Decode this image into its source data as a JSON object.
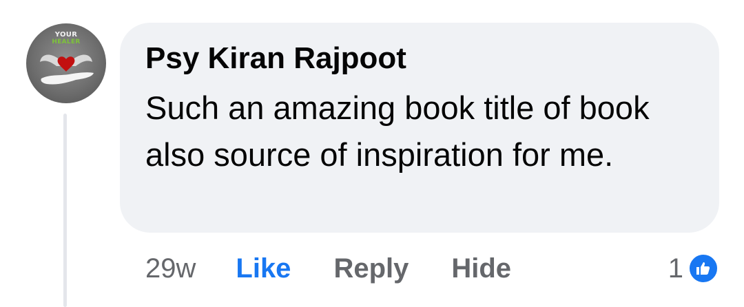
{
  "comment": {
    "avatar": {
      "text_top": "YOUR",
      "text_bottom": "HEALER"
    },
    "author": "Psy Kiran Rajpoot",
    "text": "Such an amazing book title of book also source of inspiration for me.",
    "time": "29w",
    "actions": {
      "like_label": "Like",
      "reply_label": "Reply",
      "hide_label": "Hide"
    },
    "reactions": {
      "count": "1",
      "icon": "thumbs-up-icon"
    }
  },
  "colors": {
    "bubble_bg": "#f0f2f5",
    "like_blue": "#1877f2",
    "secondary_text": "#65676b",
    "primary_text": "#050505"
  }
}
